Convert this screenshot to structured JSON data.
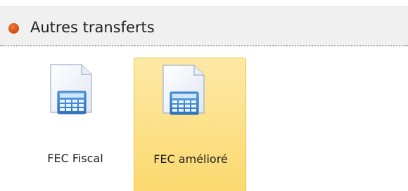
{
  "section": {
    "title": "Autres transferts",
    "bullet_color": "#e05a1c"
  },
  "tiles": [
    {
      "label": "FEC Fiscal",
      "icon": "calculator-document-icon",
      "selected": false
    },
    {
      "label": "FEC amélioré",
      "icon": "calculator-document-icon",
      "selected": true
    }
  ]
}
